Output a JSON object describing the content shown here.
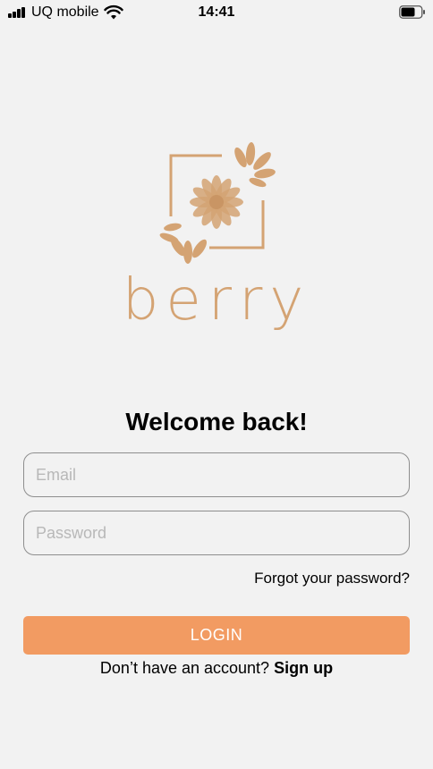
{
  "status_bar": {
    "carrier": "UQ mobile",
    "time": "14:41",
    "signal_icon": "cellular-signal-icon",
    "wifi_icon": "wifi-icon",
    "battery_icon": "battery-icon",
    "battery_level": 0.7
  },
  "logo": {
    "wordmark": "berry",
    "icon": "lotus-flower-logo-icon",
    "color": "#d4a373"
  },
  "heading": "Welcome back!",
  "form": {
    "email_placeholder": "Email",
    "email_value": "",
    "password_placeholder": "Password",
    "password_value": "",
    "forgot_label": "Forgot your password?",
    "login_label": "LOGIN",
    "login_color": "#f29b62"
  },
  "signup": {
    "prompt": "Don’t have an account?",
    "link_label": "Sign up"
  }
}
